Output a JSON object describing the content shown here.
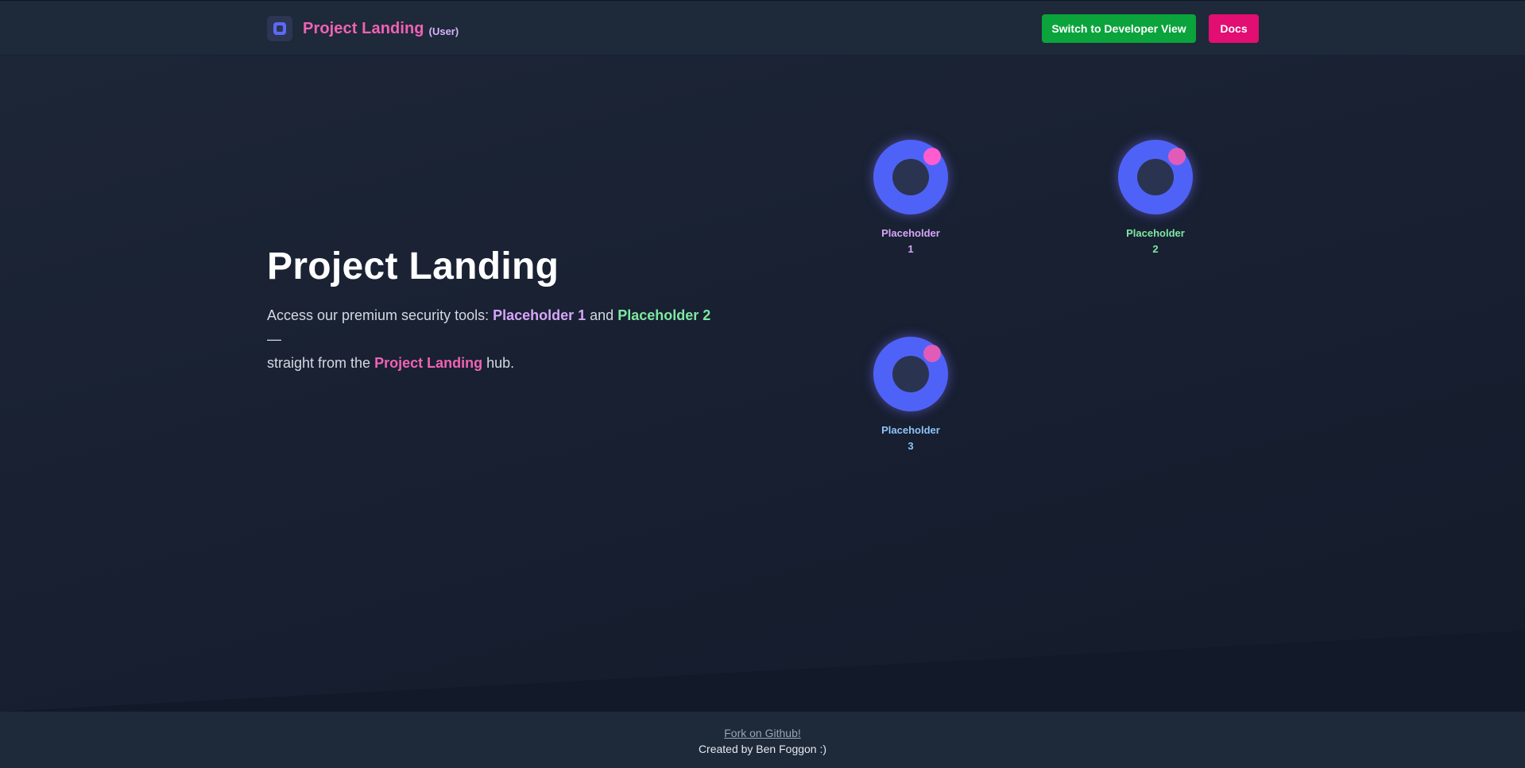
{
  "header": {
    "brand_title": "Project Landing",
    "brand_role": "(User)",
    "dev_view_button": "Switch to Developer View",
    "docs_button": "Docs"
  },
  "hero": {
    "title": "Project Landing",
    "text_before": "Access our premium security tools: ",
    "highlight_1": "Placeholder 1",
    "text_and": " and ",
    "highlight_2": "Placeholder 2",
    "text_dash": " —",
    "text_straight": "straight from the ",
    "highlight_brand": "Project Landing",
    "text_end": " hub."
  },
  "tools": [
    {
      "label_line1": "Placeholder",
      "label_line2": "1"
    },
    {
      "label_line1": "Placeholder",
      "label_line2": "2"
    },
    {
      "label_line1": "Placeholder",
      "label_line2": "3"
    }
  ],
  "footer": {
    "github_link": "Fork on Github!",
    "credit": "Created by Ben Foggon :)"
  },
  "colors": {
    "brand_pink": "#f062b4",
    "dev_button_green": "#0aa33c",
    "docs_button_pink": "#e20e72",
    "tool_ring_blue": "#4f62f7",
    "tool_1_label": "#d6a6f8",
    "tool_2_label": "#7ee8a1",
    "tool_3_label": "#8fc4f7"
  },
  "icons": {
    "brand_logo": "app-logo-icon",
    "tool_icon": "donut-icon"
  }
}
